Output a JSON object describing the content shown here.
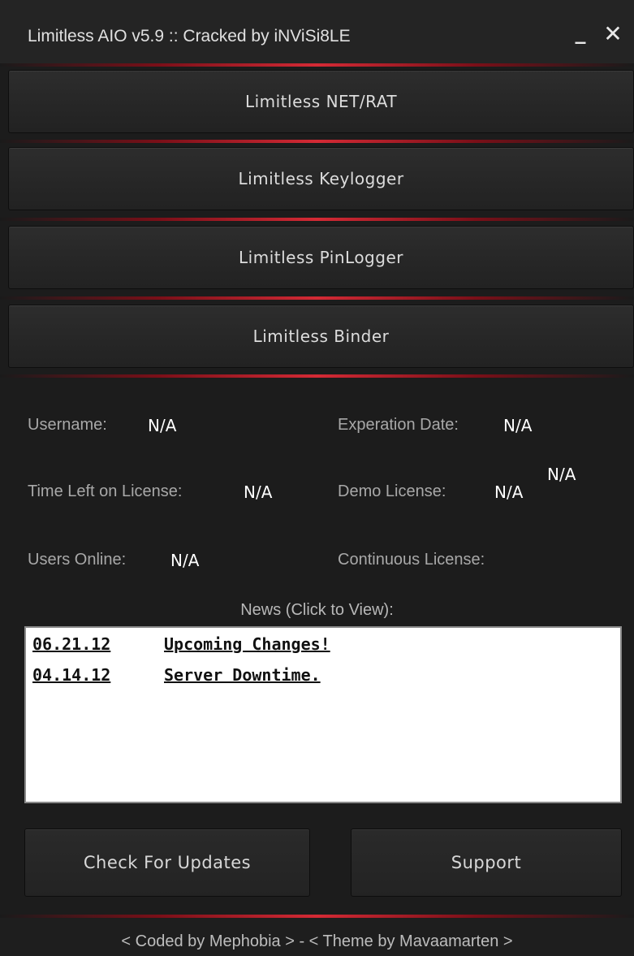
{
  "window": {
    "title": "Limitless AIO v5.9 :: Cracked by iNViSi8LE",
    "minimize_glyph": "_",
    "close_glyph": "✕"
  },
  "menu": {
    "items": [
      {
        "label": "Limitless NET/RAT"
      },
      {
        "label": "Limitless Keylogger"
      },
      {
        "label": "Limitless PinLogger"
      },
      {
        "label": "Limitless Binder"
      }
    ]
  },
  "info": {
    "username_label": "Username:",
    "username_value": "N/A",
    "expiration_label": "Experation Date:",
    "expiration_value": "N/A",
    "time_left_label": "Time Left on License:",
    "time_left_value": "N/A",
    "demo_label": "Demo License:",
    "demo_value": "N/A",
    "continuous_value": "N/A",
    "users_online_label": "Users Online:",
    "users_online_value": "N/A",
    "continuous_label": "Continuous License:"
  },
  "news": {
    "heading": "News (Click to View):",
    "items": [
      {
        "date": "06.21.12",
        "title": "Upcoming Changes!"
      },
      {
        "date": "04.14.12",
        "title": "Server Downtime."
      }
    ]
  },
  "actions": {
    "check_updates": "Check For Updates",
    "support": "Support"
  },
  "footer": {
    "text": "< Coded by Mephobia > - < Theme by Mavaamarten >"
  },
  "colors": {
    "accent": "#d42a35",
    "background": "#1c1c1c"
  }
}
